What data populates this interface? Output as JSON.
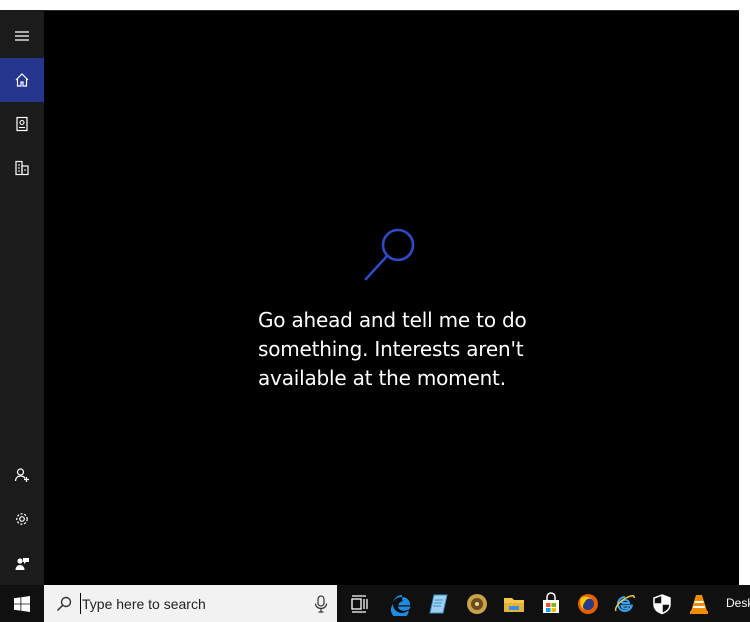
{
  "cortana": {
    "message": "Go ahead and tell me to do something. Interests aren't available at the moment."
  },
  "sidebar": {
    "items": [
      {
        "name": "hamburger-menu-icon"
      },
      {
        "name": "home-icon",
        "active": true
      },
      {
        "name": "notebook-icon"
      },
      {
        "name": "devices-icon"
      },
      {
        "name": "add-person-icon"
      },
      {
        "name": "gear-icon"
      },
      {
        "name": "feedback-icon"
      }
    ]
  },
  "taskbar": {
    "search_placeholder": "Type here to search",
    "apps": [
      "task-view-icon",
      "edge-icon",
      "notepad-icon",
      "media-icon",
      "file-explorer-icon",
      "store-icon",
      "firefox-icon",
      "internet-explorer-icon",
      "security-icon",
      "vlc-icon"
    ],
    "desk_label": "Desk"
  },
  "colors": {
    "accent": "#26368f",
    "glyph": "#2f49c9",
    "sidebar": "#1b1b1b",
    "taskbar": "#101010"
  }
}
